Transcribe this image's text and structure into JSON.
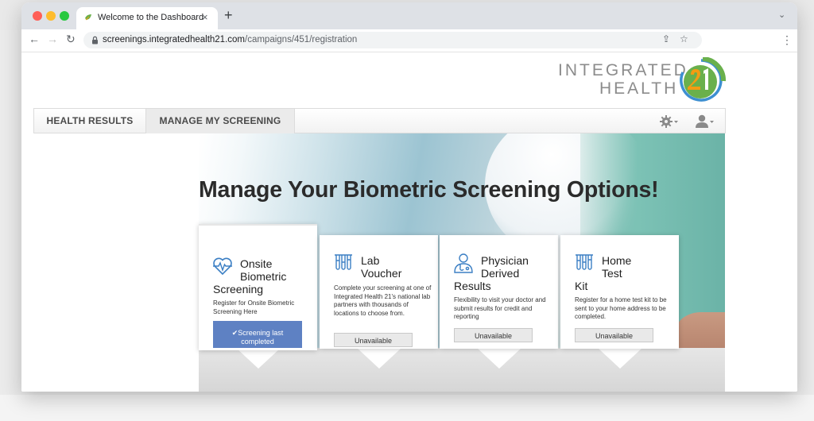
{
  "browser": {
    "tab_title": "Welcome to the Dashboard",
    "tab_close_glyph": "×",
    "new_tab_glyph": "+",
    "tab_search_glyph": "⌄",
    "url_host": "screenings.integratedhealth21.com",
    "url_path": "/campaigns/451/registration",
    "back_glyph": "←",
    "forward_glyph": "→",
    "reload_glyph": "↻",
    "share_glyph": "⇪",
    "bookmark_glyph": "☆",
    "menu_glyph": "⋮",
    "icons": [
      "lock-icon",
      "share-icon",
      "star-icon",
      "kebab-menu-icon"
    ]
  },
  "logo": {
    "line1": "INTEGRATED",
    "line2": "HEALTH",
    "mark_text": "21",
    "colors": {
      "text": "#8c8c8c",
      "orange": "#f39c12",
      "green": "#6ab04c",
      "blue": "#3d8fd1"
    }
  },
  "nav": {
    "tabs": [
      {
        "label": "HEALTH RESULTS",
        "active": false
      },
      {
        "label": "MANAGE MY SCREENING",
        "active": true
      }
    ],
    "icons": [
      "gear-icon",
      "user-icon"
    ]
  },
  "main": {
    "heading": "Manage Your Biometric Screening Options!",
    "cards": [
      {
        "icon": "heart-pulse-icon",
        "title_line1": "Onsite",
        "title_line2": "Biometric",
        "title_line3": "Screening",
        "description": "Register for Onsite Biometric Screening Here",
        "button_label": "✔Screening last completed"
      },
      {
        "icon": "test-tubes-icon",
        "title_line1": "Lab",
        "title_line2": "Voucher",
        "description": "Complete your screening at one of Integrated Health 21's national lab partners with thousands of locations to choose from.",
        "button_label": "Unavailable"
      },
      {
        "icon": "physician-icon",
        "title_line1": "Physician",
        "title_line2": "Derived",
        "title_line3": "Results",
        "description": "Flexibility to visit your doctor and submit results for credit and reporting",
        "button_label": "Unavailable"
      },
      {
        "icon": "test-tubes-icon",
        "title_line1": "Home",
        "title_line2": "Test",
        "title_line3": "Kit",
        "description": "Register for a home test kit to be sent to your home address to be completed.",
        "button_label": "Unavailable"
      }
    ]
  },
  "colors": {
    "primary_button": "#5e81c3",
    "icon_blue": "#3b7fc4",
    "heading_text": "#2b2b2b"
  }
}
